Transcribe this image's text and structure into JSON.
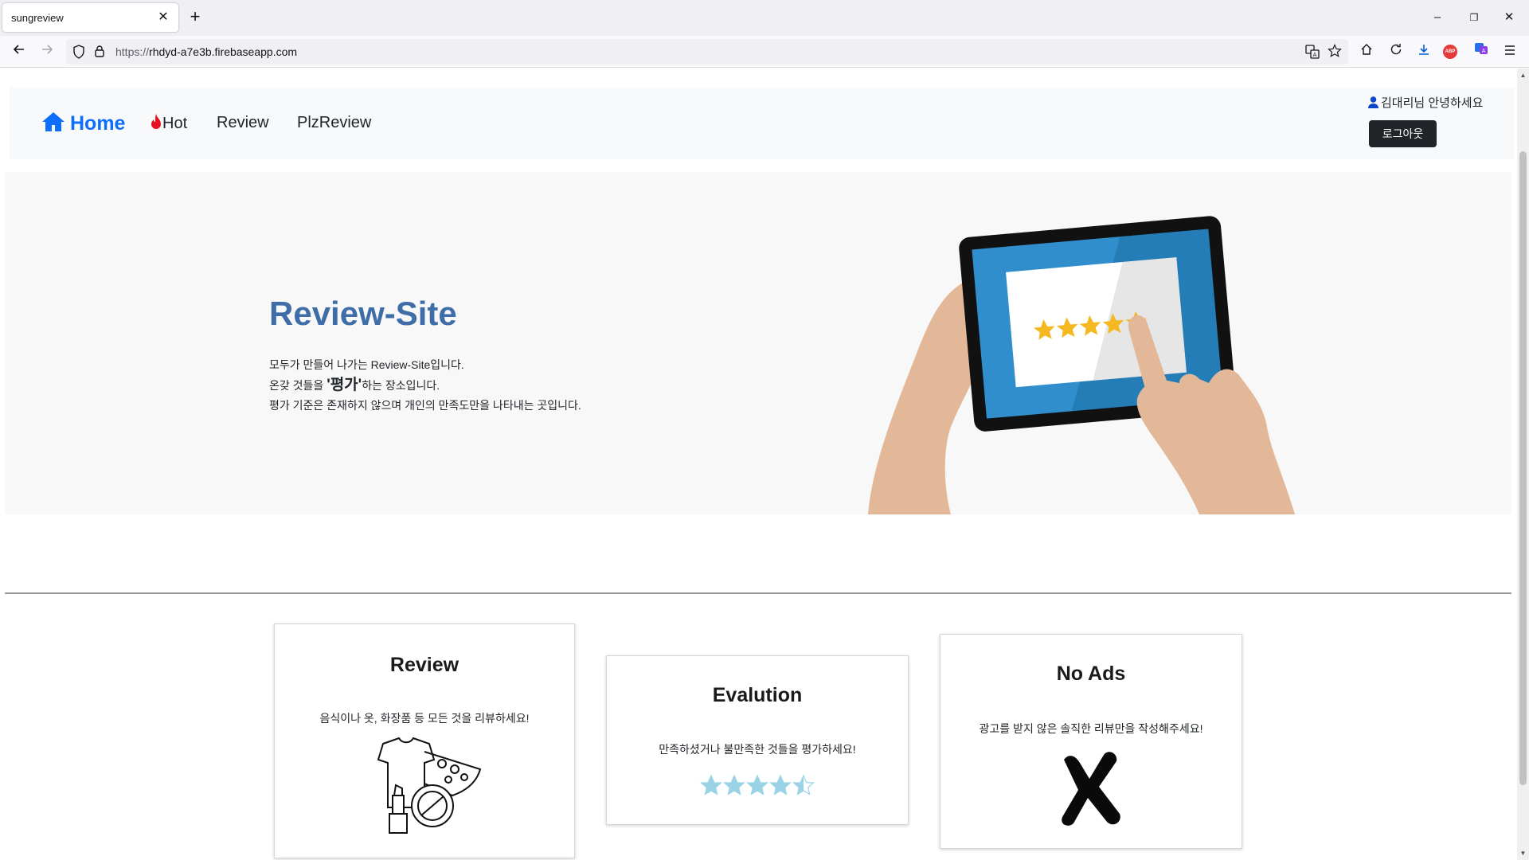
{
  "browser": {
    "tab_title": "sungreview",
    "url_scheme": "https://",
    "url_host": "rhdyd-a7e3b.firebaseapp.com"
  },
  "site": {
    "nav": {
      "brand": "Home",
      "hot": "Hot",
      "review": "Review",
      "plz_review": "PlzReview"
    },
    "user": {
      "greeting": "김대리님 안녕하세요",
      "logout": "로그아웃"
    },
    "hero": {
      "title": "Review-Site",
      "line1": "모두가 만들어 나가는 Review-Site입니다.",
      "line2_pre": "온갖 것들을 ",
      "line2_emph": "'평가'",
      "line2_post": "하는 장소입니다.",
      "line3": "평가 기준은 존재하지 않으며 개인의 만족도만을 나타내는 곳입니다.",
      "tablet_rating_stars": 5
    },
    "cards": [
      {
        "title": "Review",
        "text": "음식이나 옷, 화장품 등 모든 것을 리뷰하세요!",
        "icon": "clothes-cosmetics-pizza-icon"
      },
      {
        "title": "Evalution",
        "text": "만족하셨거나 불만족한 것들을 평가하세요!",
        "icon": "star-rating-icon",
        "rating": 4.5
      },
      {
        "title": "No Ads",
        "text": "광고를 받지 않은 솔직한 리뷰만을 작성해주세요!",
        "icon": "x-mark-icon"
      }
    ]
  },
  "colors": {
    "brand": "#0d6efd",
    "hero_title": "#3e6da8",
    "star_gold": "#f5b820",
    "star_blue": "#9ad3e6",
    "button_dark": "#212529"
  }
}
